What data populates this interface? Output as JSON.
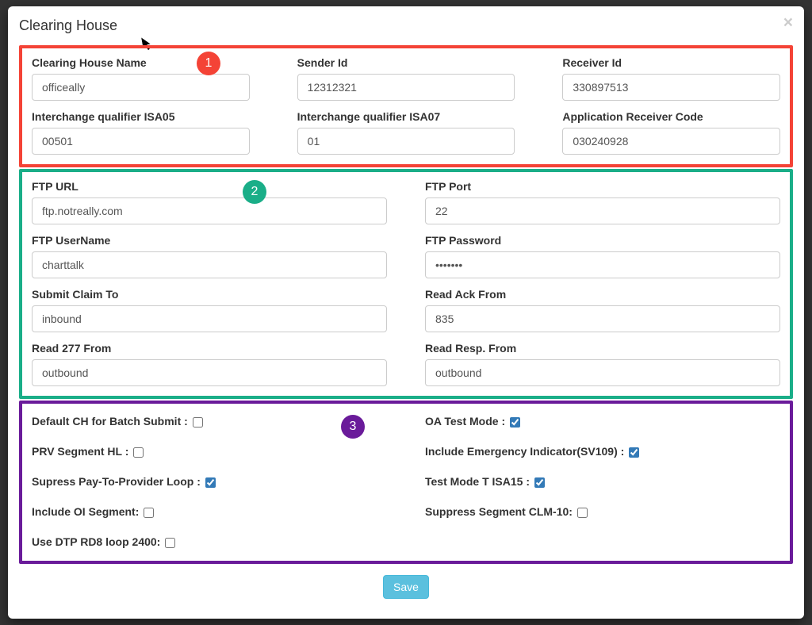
{
  "modal": {
    "title": "Clearing House",
    "close_glyph": "×"
  },
  "badges": {
    "one": "1",
    "two": "2",
    "three": "3"
  },
  "section1": {
    "clearing_house_name": {
      "label": "Clearing House Name",
      "value": "officeally"
    },
    "sender_id": {
      "label": "Sender Id",
      "value": "12312321"
    },
    "receiver_id": {
      "label": "Receiver Id",
      "value": "330897513"
    },
    "isa05": {
      "label": "Interchange qualifier ISA05",
      "value": "00501"
    },
    "isa07": {
      "label": "Interchange qualifier ISA07",
      "value": "01"
    },
    "app_recv_code": {
      "label": "Application Receiver Code",
      "value": "030240928"
    }
  },
  "section2": {
    "ftp_url": {
      "label": "FTP URL",
      "value": "ftp.notreally.com"
    },
    "ftp_port": {
      "label": "FTP Port",
      "value": "22"
    },
    "ftp_user": {
      "label": "FTP UserName",
      "value": "charttalk"
    },
    "ftp_pass": {
      "label": "FTP Password",
      "value": "•••••••"
    },
    "submit_claim_to": {
      "label": "Submit Claim To",
      "value": "inbound"
    },
    "read_ack_from": {
      "label": "Read Ack From",
      "value": "835"
    },
    "read_277_from": {
      "label": "Read 277 From",
      "value": "outbound"
    },
    "read_resp_from": {
      "label": "Read Resp. From",
      "value": "outbound"
    }
  },
  "section3": {
    "default_ch": {
      "label": "Default CH for Batch Submit : ",
      "checked": false
    },
    "oa_test": {
      "label": "OA Test Mode : ",
      "checked": true
    },
    "prv_seg": {
      "label": "PRV Segment HL : ",
      "checked": false
    },
    "emerg_ind": {
      "label": "Include Emergency Indicator(SV109) : ",
      "checked": true
    },
    "supress_paytp": {
      "label": "Supress Pay-To-Provider Loop : ",
      "checked": true
    },
    "test_isa15": {
      "label": "Test Mode T ISA15 : ",
      "checked": true
    },
    "include_oi": {
      "label": "Include OI Segment: ",
      "checked": false
    },
    "suppress_clm10": {
      "label": "Suppress Segment CLM-10: ",
      "checked": false
    },
    "use_dtp_rd8": {
      "label": "Use DTP RD8 loop 2400: ",
      "checked": false
    }
  },
  "footer": {
    "save_label": "Save"
  }
}
